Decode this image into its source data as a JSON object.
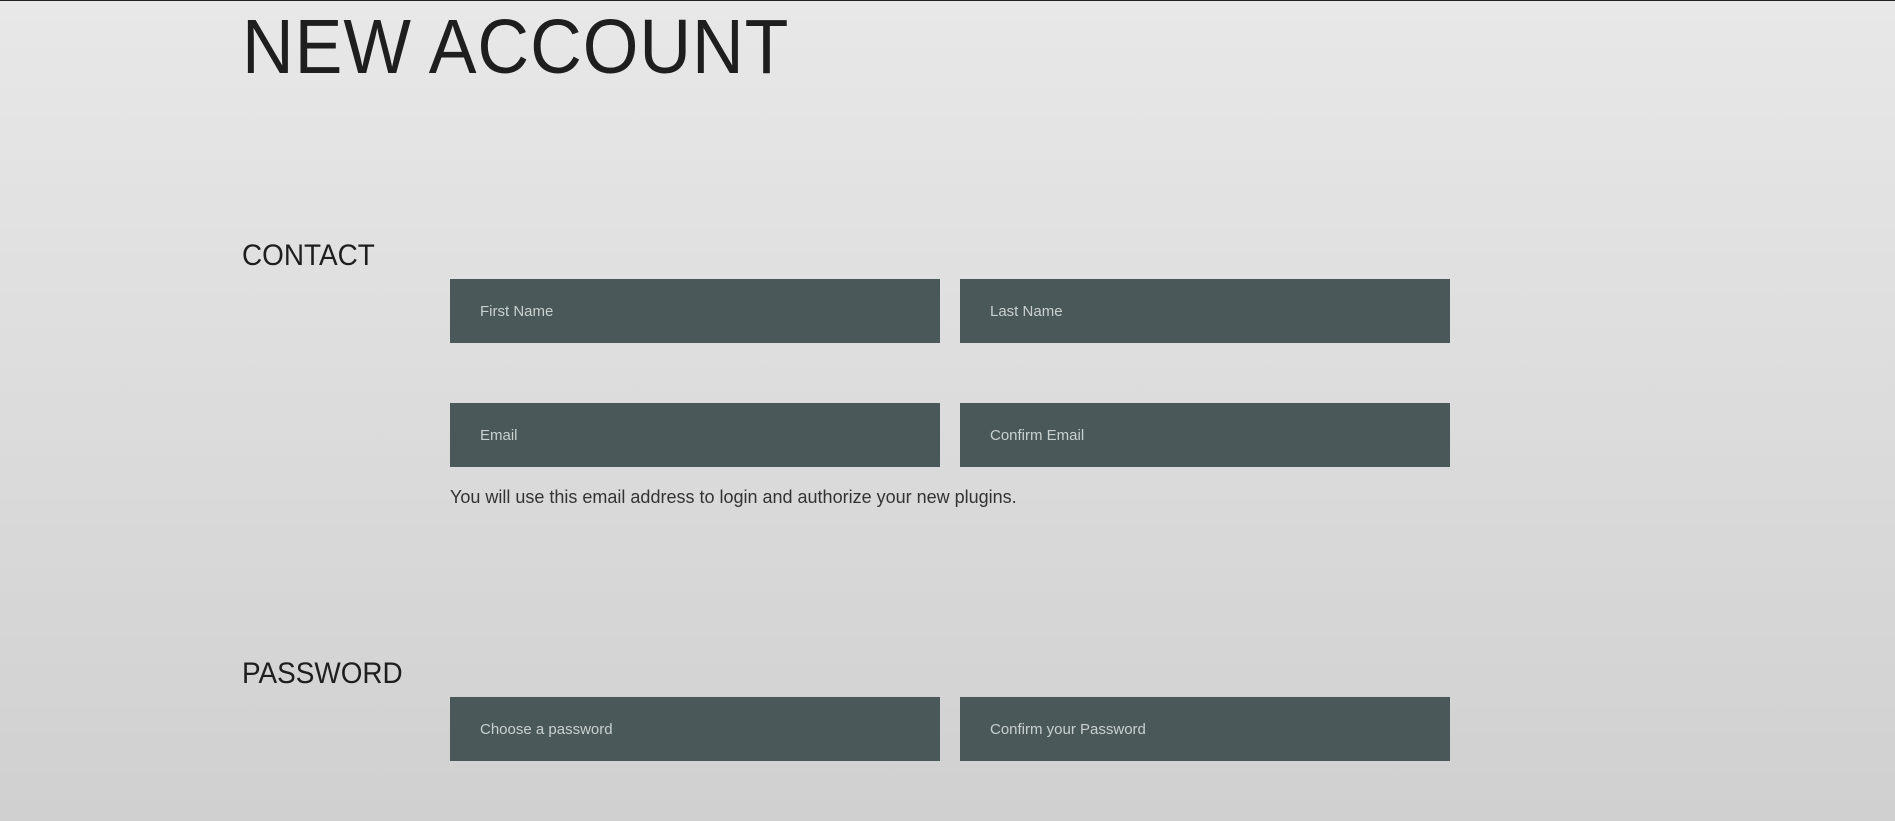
{
  "page": {
    "title": "NEW ACCOUNT"
  },
  "contact": {
    "heading": "CONTACT",
    "first_name_placeholder": "First Name",
    "last_name_placeholder": "Last Name",
    "email_placeholder": "Email",
    "confirm_email_placeholder": "Confirm Email",
    "help_text": "You will use this email address to login and authorize your new plugins."
  },
  "password": {
    "heading": "PASSWORD",
    "password_placeholder": "Choose a password",
    "confirm_password_placeholder": "Confirm your Password"
  }
}
